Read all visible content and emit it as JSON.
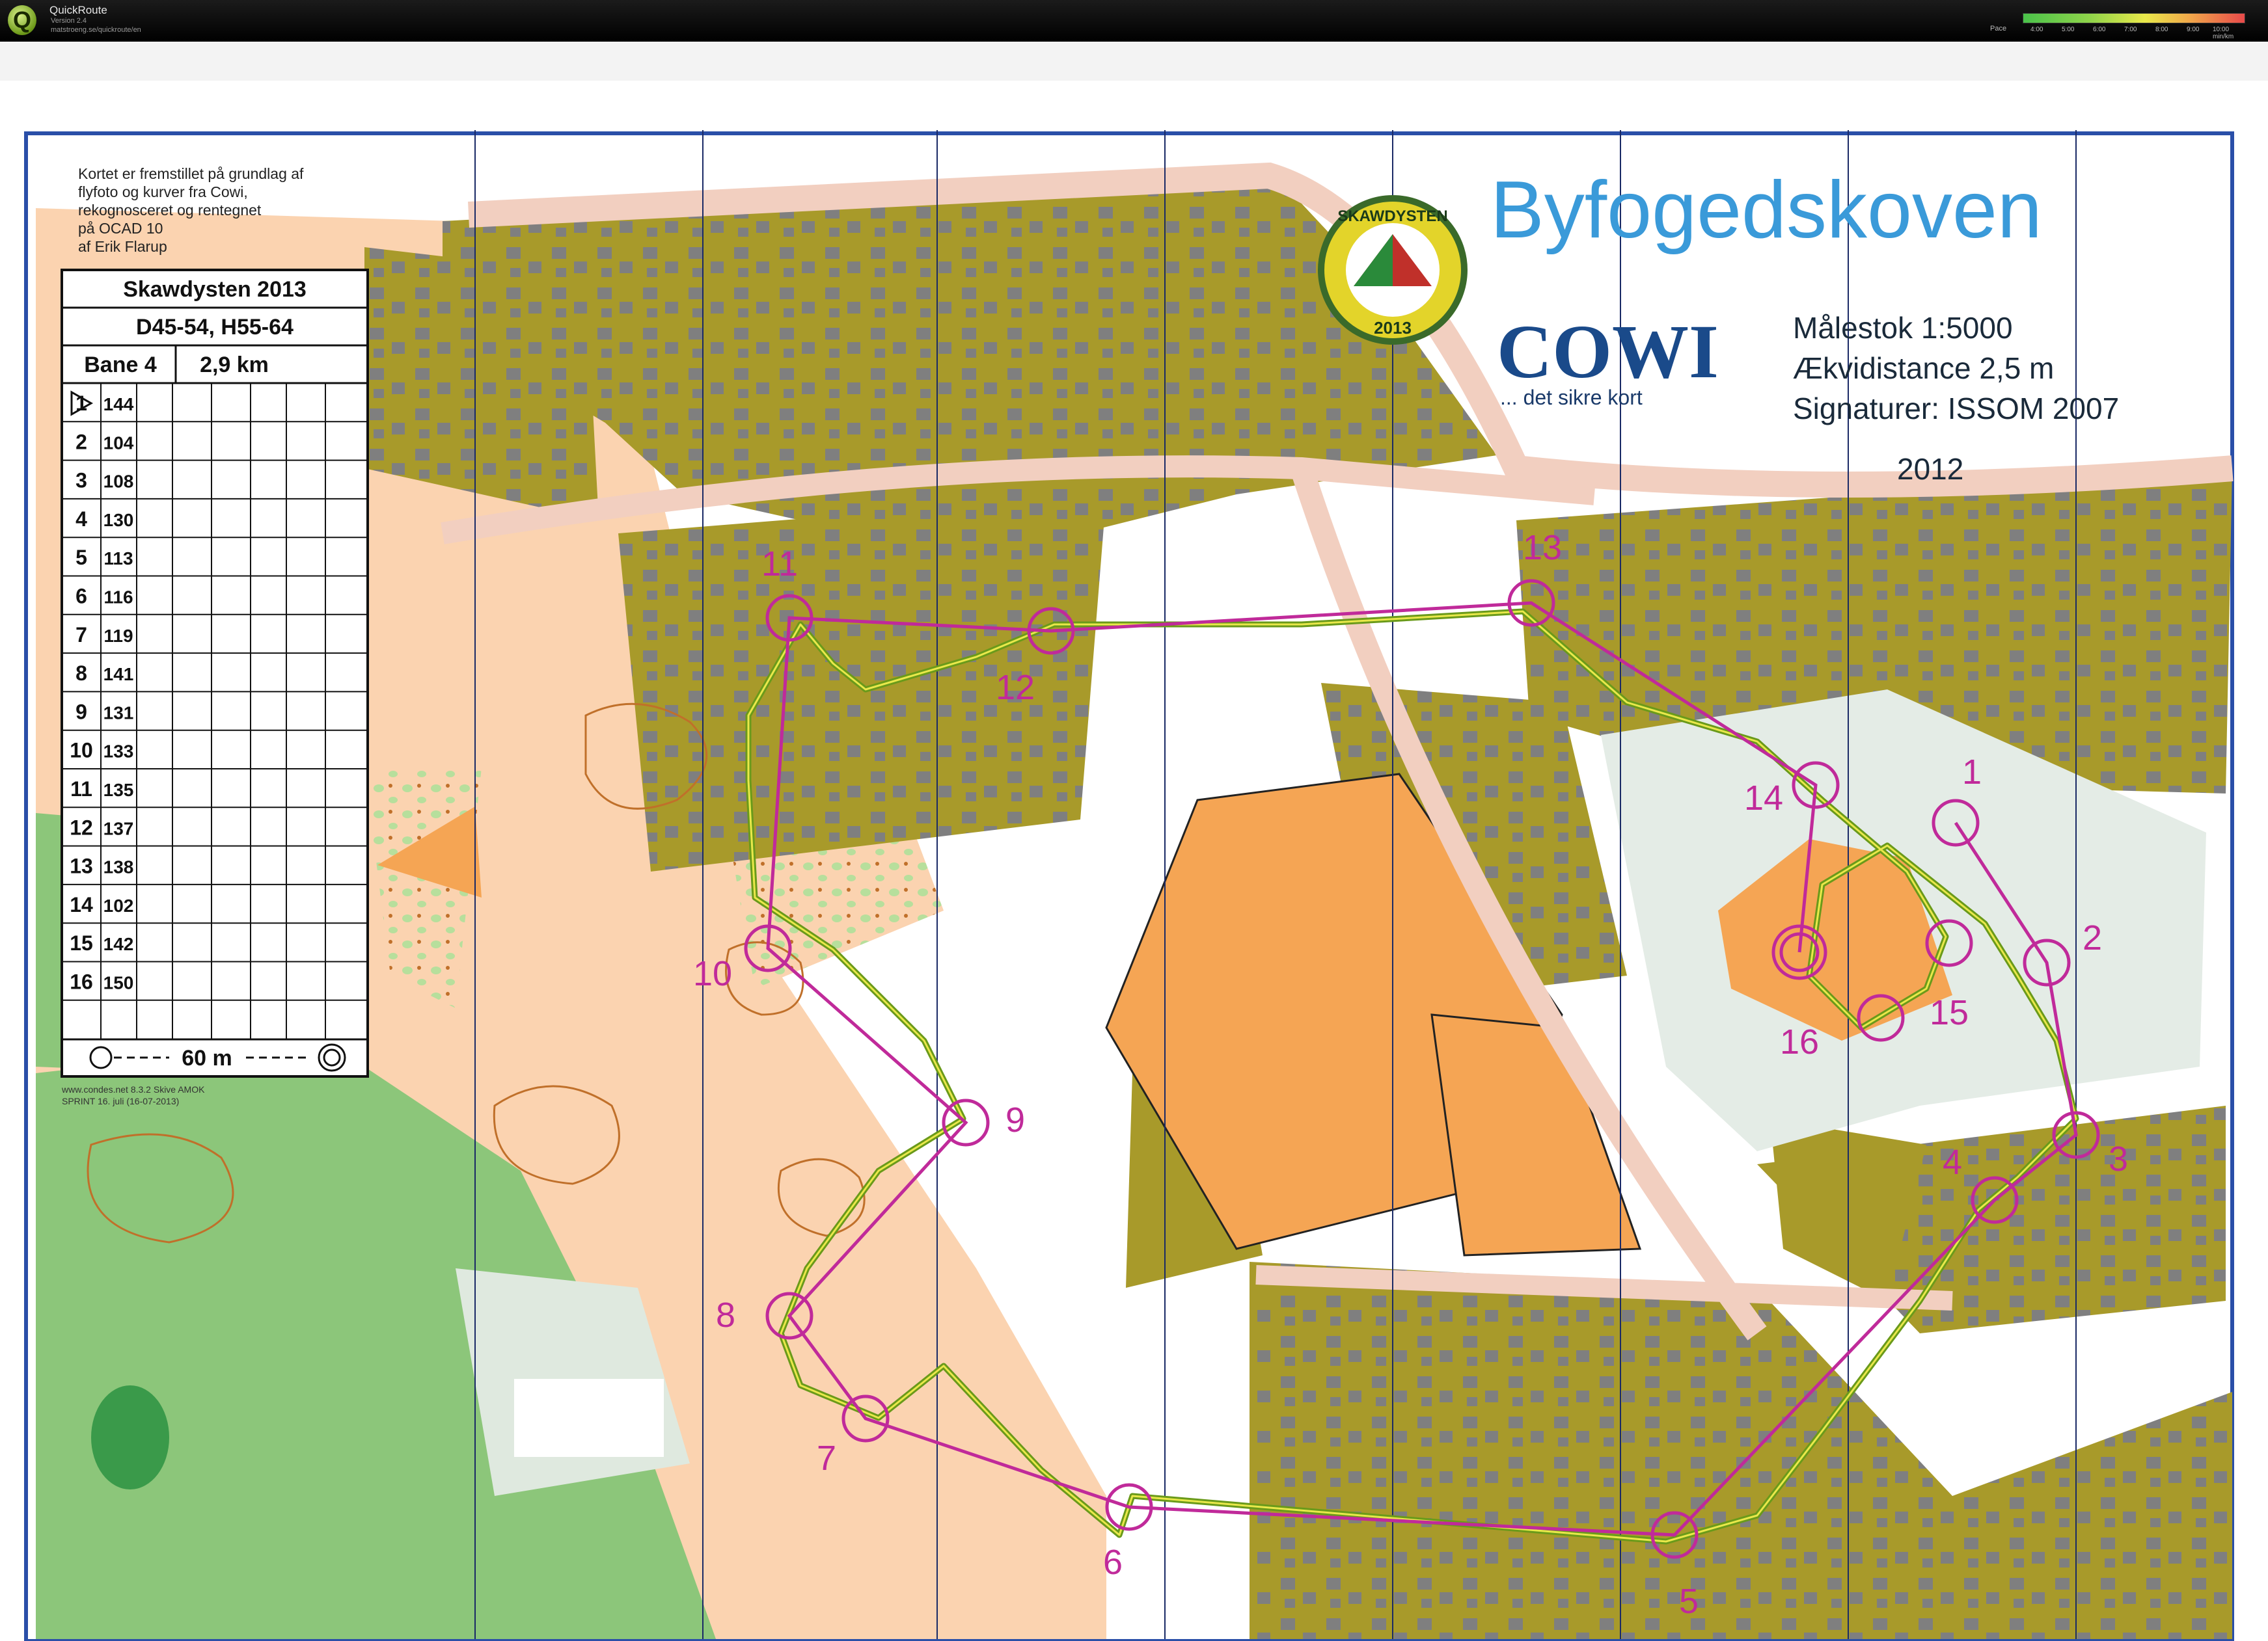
{
  "app": {
    "logo_letter": "Q",
    "name": "QuickRoute",
    "version": "Version 2.4",
    "url": "matstroeng.se/quickroute/en"
  },
  "pace_legend": {
    "label": "Pace",
    "ticks": [
      "4:00",
      "5:00",
      "6:00",
      "7:00",
      "8:00",
      "9:00",
      "10:00 min/km"
    ]
  },
  "map": {
    "title": "Byfogedskoven",
    "credits_text": [
      "Kortet er fremstillet på grundlag af",
      "flyfoto og kurver fra Cowi,",
      "rekognosceret og rentegnet",
      "på OCAD 10",
      "af Erik Flarup"
    ],
    "logo_event_name": "SKAWDYSTEN",
    "logo_year": "2013",
    "sponsor_name": "COWI",
    "sponsor_tagline": "... det sikre kort",
    "scale": "Målestok 1:5000",
    "contour_interval": "Ækvidistance 2,5 m",
    "symbols": "Signaturer: ISSOM 2007",
    "year": "2012",
    "print_note": [
      "www.condes.net 8.3.2 Skive AMOK",
      "SPRINT 16. juli (16-07-2013)"
    ]
  },
  "control_description": {
    "event": "Skawdysten 2013",
    "classes": "D45-54, H55-64",
    "course": "Bane 4",
    "length": "2,9 km",
    "rows": [
      {
        "num": "1",
        "code": "144"
      },
      {
        "num": "2",
        "code": "104"
      },
      {
        "num": "3",
        "code": "108"
      },
      {
        "num": "4",
        "code": "130"
      },
      {
        "num": "5",
        "code": "113"
      },
      {
        "num": "6",
        "code": "116"
      },
      {
        "num": "7",
        "code": "119"
      },
      {
        "num": "8",
        "code": "141"
      },
      {
        "num": "9",
        "code": "131"
      },
      {
        "num": "10",
        "code": "133"
      },
      {
        "num": "11",
        "code": "135"
      },
      {
        "num": "12",
        "code": "137"
      },
      {
        "num": "13",
        "code": "138"
      },
      {
        "num": "14",
        "code": "102"
      },
      {
        "num": "15",
        "code": "142"
      },
      {
        "num": "16",
        "code": "150"
      }
    ],
    "finish_distance": "60 m"
  },
  "course_controls": [
    {
      "label": "1"
    },
    {
      "label": "2"
    },
    {
      "label": "3"
    },
    {
      "label": "4"
    },
    {
      "label": "5"
    },
    {
      "label": "6"
    },
    {
      "label": "7"
    },
    {
      "label": "8"
    },
    {
      "label": "9"
    },
    {
      "label": "10"
    },
    {
      "label": "11"
    },
    {
      "label": "12"
    },
    {
      "label": "13"
    },
    {
      "label": "14"
    },
    {
      "label": "15"
    },
    {
      "label": "16"
    }
  ],
  "colors": {
    "course": "#c02a9a",
    "route": "#6a9a1a",
    "settlement": "#a89a2a",
    "open_land": "#f5a554",
    "rough_open": "#fbd3b0",
    "forest": "#8cc67a",
    "paved": "#f2cfc0"
  }
}
